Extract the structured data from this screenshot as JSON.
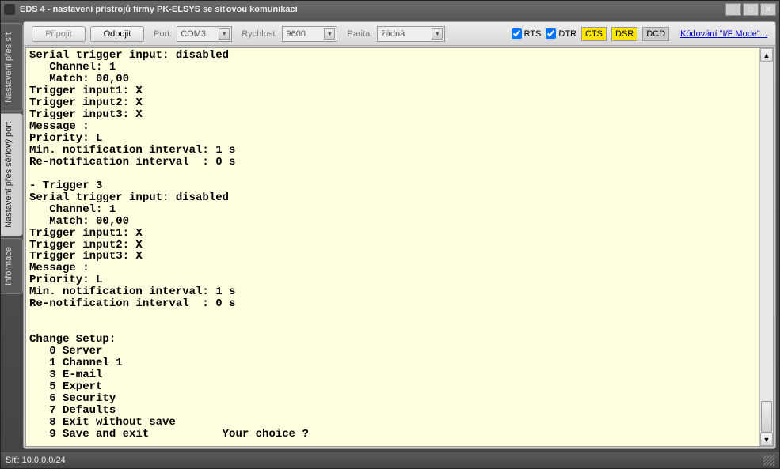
{
  "window": {
    "title": "EDS 4 - nastavení přístrojů firmy PK-ELSYS se síťovou komunikací"
  },
  "tabs": {
    "network": "Nastavení přes síť",
    "serial": "Nastavení přes sériový port",
    "info": "Informace"
  },
  "toolbar": {
    "connect": "Připojit",
    "disconnect": "Odpojit",
    "port_label": "Port:",
    "port_value": "COM3",
    "speed_label": "Rychlost:",
    "speed_value": "9600",
    "parity_label": "Parita:",
    "parity_value": "žádná",
    "rts": "RTS",
    "dtr": "DTR",
    "cts": "CTS",
    "dsr": "DSR",
    "dcd": "DCD",
    "link": "Kódování \"I/F Mode\"..."
  },
  "terminal": "Serial trigger input: disabled\n   Channel: 1\n   Match: 00,00\nTrigger input1: X\nTrigger input2: X\nTrigger input3: X\nMessage :\nPriority: L\nMin. notification interval: 1 s\nRe-notification interval  : 0 s\n\n- Trigger 3\nSerial trigger input: disabled\n   Channel: 1\n   Match: 00,00\nTrigger input1: X\nTrigger input2: X\nTrigger input3: X\nMessage :\nPriority: L\nMin. notification interval: 1 s\nRe-notification interval  : 0 s\n\n\nChange Setup:\n   0 Server\n   1 Channel 1\n   3 E-mail\n   5 Expert\n   6 Security\n   7 Defaults\n   8 Exit without save\n   9 Save and exit           Your choice ? ",
  "status": {
    "network": "Síť: 10.0.0.0/24"
  }
}
